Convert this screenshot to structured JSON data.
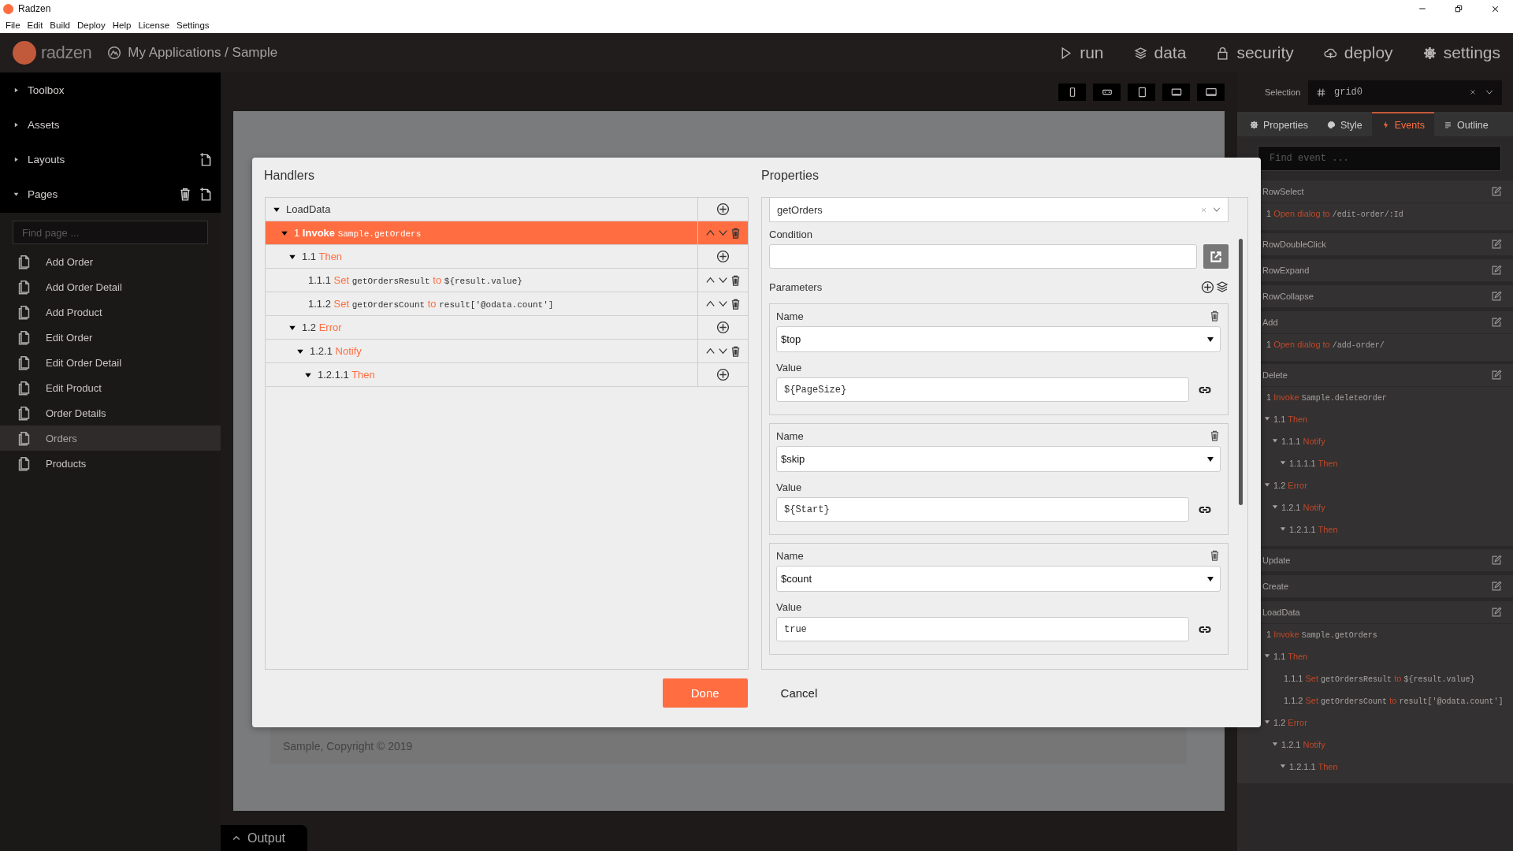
{
  "window": {
    "title": "Radzen"
  },
  "menu": [
    "File",
    "Edit",
    "Build",
    "Deploy",
    "Help",
    "License",
    "Settings"
  ],
  "header": {
    "brand": "radzen",
    "breadcrumb": "My Applications / Sample",
    "actions": [
      {
        "label": "run"
      },
      {
        "label": "data"
      },
      {
        "label": "security"
      },
      {
        "label": "deploy"
      },
      {
        "label": "settings"
      }
    ]
  },
  "sidebar": {
    "sections": [
      {
        "label": "Toolbox",
        "expanded": false
      },
      {
        "label": "Assets",
        "expanded": false
      },
      {
        "label": "Layouts",
        "expanded": false,
        "actions": [
          {
            "kind": "add"
          }
        ]
      },
      {
        "label": "Pages",
        "expanded": true,
        "actions": [
          {
            "kind": "delete"
          },
          {
            "kind": "add"
          }
        ]
      }
    ],
    "search": {
      "placeholder": "Find page ..."
    },
    "pages": [
      {
        "label": "Add Order",
        "selected": false
      },
      {
        "label": "Add Order Detail",
        "selected": false
      },
      {
        "label": "Add Product",
        "selected": false
      },
      {
        "label": "Edit Order",
        "selected": false
      },
      {
        "label": "Edit Order Detail",
        "selected": false
      },
      {
        "label": "Edit Product",
        "selected": false
      },
      {
        "label": "Order Details",
        "selected": false
      },
      {
        "label": "Orders",
        "selected": true
      },
      {
        "label": "Products",
        "selected": false
      }
    ]
  },
  "canvas": {
    "footer": "Sample, Copyright © 2019"
  },
  "output": {
    "label": "Output"
  },
  "inspector": {
    "selection_label": "Selection",
    "selection": "grid0",
    "tabs": [
      {
        "label": "Properties",
        "selected": false
      },
      {
        "label": "Style",
        "selected": false
      },
      {
        "label": "Events",
        "selected": true
      },
      {
        "label": "Outline",
        "selected": false
      }
    ],
    "search": {
      "placeholder": "Find event ..."
    },
    "events": [
      {
        "name": "RowSelect",
        "actions": [
          {
            "number": "1",
            "verb": "Open dialog to",
            "target": "/edit-order/:Id"
          }
        ]
      },
      {
        "name": "RowDoubleClick"
      },
      {
        "name": "RowExpand"
      },
      {
        "name": "RowCollapse"
      },
      {
        "name": "Add",
        "actions": [
          {
            "number": "1",
            "verb": "Open dialog to",
            "target": "/add-order/"
          }
        ]
      },
      {
        "name": "Delete",
        "actions": [
          {
            "number": "1",
            "verb": "Invoke",
            "target": "Sample.deleteOrder",
            "children": [
              {
                "number": "1.1",
                "verb": "Then",
                "expanded": true,
                "children": [
                  {
                    "number": "1.1.1",
                    "verb": "Notify",
                    "expanded": true,
                    "children": [
                      {
                        "number": "1.1.1.1",
                        "verb": "Then",
                        "expanded": true
                      }
                    ]
                  }
                ]
              },
              {
                "number": "1.2",
                "verb": "Error",
                "expanded": true,
                "children": [
                  {
                    "number": "1.2.1",
                    "verb": "Notify",
                    "expanded": true,
                    "children": [
                      {
                        "number": "1.2.1.1",
                        "verb": "Then",
                        "expanded": true
                      }
                    ]
                  }
                ]
              }
            ]
          }
        ]
      },
      {
        "name": "Update"
      },
      {
        "name": "Create"
      },
      {
        "name": "LoadData",
        "actions": [
          {
            "number": "1",
            "verb": "Invoke",
            "target": "Sample.getOrders",
            "children": [
              {
                "number": "1.1",
                "verb": "Then",
                "expanded": true,
                "children": [
                  {
                    "number": "1.1.1",
                    "verb": "Set",
                    "target": "getOrdersResult",
                    "connector": "to",
                    "value": "${result.value}"
                  },
                  {
                    "number": "1.1.2",
                    "verb": "Set",
                    "target": "getOrdersCount",
                    "connector": "to",
                    "value": "result['@odata.count']"
                  }
                ]
              },
              {
                "number": "1.2",
                "verb": "Error",
                "expanded": true,
                "children": [
                  {
                    "number": "1.2.1",
                    "verb": "Notify",
                    "expanded": true,
                    "children": [
                      {
                        "number": "1.2.1.1",
                        "verb": "Then",
                        "expanded": true
                      }
                    ]
                  }
                ]
              }
            ]
          }
        ]
      }
    ]
  },
  "dialog": {
    "handlers_title": "Handlers",
    "properties_title": "Properties",
    "handlers": [
      {
        "label": "LoadData",
        "expanded": true,
        "kind": "add",
        "selected": false,
        "children": [
          {
            "number": "1",
            "verb": "Invoke",
            "target": "Sample.getOrders",
            "expanded": true,
            "kind": "reorder",
            "selected": true,
            "children": [
              {
                "number": "1.1",
                "verb": "Then",
                "expanded": true,
                "kind": "add",
                "selected": false,
                "children": [
                  {
                    "number": "1.1.1",
                    "verb": "Set",
                    "target": "getOrdersResult",
                    "connector": "to",
                    "value": "${result.value}",
                    "kind": "reorder",
                    "selected": false
                  },
                  {
                    "number": "1.1.2",
                    "verb": "Set",
                    "target": "getOrdersCount",
                    "connector": "to",
                    "value": "result['@odata.count']",
                    "kind": "reorder",
                    "selected": false
                  }
                ]
              },
              {
                "number": "1.2",
                "verb": "Error",
                "expanded": true,
                "kind": "add",
                "selected": false,
                "children": [
                  {
                    "number": "1.2.1",
                    "verb": "Notify",
                    "expanded": true,
                    "kind": "reorder",
                    "selected": false,
                    "children": [
                      {
                        "number": "1.2.1.1",
                        "verb": "Then",
                        "expanded": true,
                        "kind": "add",
                        "selected": false
                      }
                    ]
                  }
                ]
              }
            ]
          }
        ]
      }
    ],
    "method": "getOrders",
    "condition_label": "Condition",
    "parameters_label": "Parameters",
    "parameters": [
      {
        "name_label": "Name",
        "name": "$top",
        "value_label": "Value",
        "value": "${PageSize}"
      },
      {
        "name_label": "Name",
        "name": "$skip",
        "value_label": "Value",
        "value": "${Start}"
      },
      {
        "name_label": "Name",
        "name": "$count",
        "value_label": "Value",
        "value": "true"
      }
    ],
    "buttons": [
      {
        "label": "Done",
        "kind": "primary"
      },
      {
        "label": "Cancel",
        "kind": "plain"
      }
    ]
  }
}
